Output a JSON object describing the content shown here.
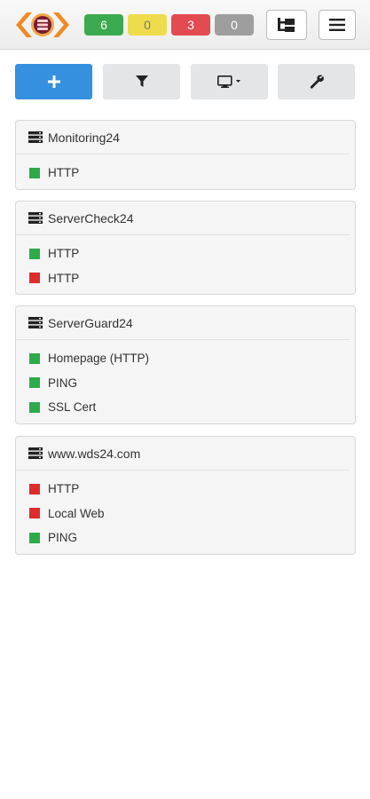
{
  "header": {
    "logo_icon": "eye-server-logo-icon",
    "status_counts": {
      "ok": "6",
      "warning": "0",
      "critical": "3",
      "unknown": "0"
    },
    "colors": {
      "ok": "#3caa4e",
      "warning": "#eedc4c",
      "critical": "#e24b51",
      "unknown": "#9e9e9e",
      "primary": "#3590e0"
    },
    "buttons": {
      "tree_icon": "tree-view-icon",
      "menu_icon": "hamburger-menu-icon"
    }
  },
  "toolbar": {
    "add_icon": "plus-icon",
    "filter_icon": "filter-icon",
    "display_icon": "monitor-dropdown-icon",
    "tools_icon": "wrench-icon"
  },
  "servers": [
    {
      "name": "Monitoring24",
      "checks": [
        {
          "label": "HTTP",
          "status": "ok"
        }
      ]
    },
    {
      "name": "ServerCheck24",
      "checks": [
        {
          "label": "HTTP",
          "status": "ok"
        },
        {
          "label": "HTTP",
          "status": "down"
        }
      ]
    },
    {
      "name": "ServerGuard24",
      "checks": [
        {
          "label": "Homepage (HTTP)",
          "status": "ok"
        },
        {
          "label": "PING",
          "status": "ok"
        },
        {
          "label": "SSL Cert",
          "status": "ok"
        }
      ]
    },
    {
      "name": "www.wds24.com",
      "checks": [
        {
          "label": "HTTP",
          "status": "down"
        },
        {
          "label": "Local Web",
          "status": "down"
        },
        {
          "label": "PING",
          "status": "ok"
        }
      ]
    }
  ]
}
